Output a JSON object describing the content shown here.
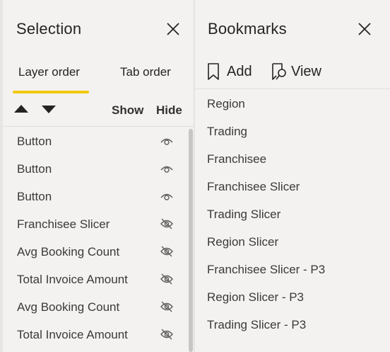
{
  "selection": {
    "title": "Selection",
    "tabs": {
      "layer_order": "Layer order",
      "tab_order": "Tab order"
    },
    "columns": {
      "show": "Show",
      "hide": "Hide"
    },
    "layers": [
      {
        "label": "Button",
        "visible": true
      },
      {
        "label": "Button",
        "visible": true
      },
      {
        "label": "Button",
        "visible": true
      },
      {
        "label": "Franchisee Slicer",
        "visible": false
      },
      {
        "label": "Avg Booking Count",
        "visible": false
      },
      {
        "label": "Total Invoice Amount",
        "visible": false
      },
      {
        "label": "Avg Booking Count",
        "visible": false
      },
      {
        "label": "Total Invoice Amount",
        "visible": false
      }
    ]
  },
  "bookmarks": {
    "title": "Bookmarks",
    "add_label": "Add",
    "view_label": "View",
    "items": [
      "Region",
      "Trading",
      "Franchisee",
      "Franchisee Slicer",
      "Trading Slicer",
      "Region Slicer",
      "Franchisee Slicer - P3",
      "Region Slicer - P3",
      "Trading Slicer - P3"
    ]
  },
  "colors": {
    "pane_background": "#f3f2f1",
    "accent_underline": "#f2c80f",
    "text": "#252423"
  }
}
